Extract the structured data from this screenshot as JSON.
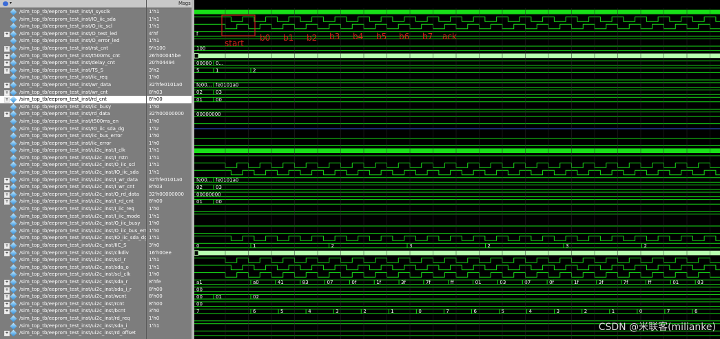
{
  "header": {
    "msgs": "Msgs"
  },
  "signals": [
    {
      "name": "/sim_top_tb/eeprom_test_inst/I_sysclk",
      "value": "1'h1",
      "exp": false,
      "sel": false,
      "type": "clock",
      "period": 8,
      "color": "#18e018"
    },
    {
      "name": "/sim_top_tb/eeprom_test_inst/IO_iic_sda",
      "value": "1'h1",
      "exp": false,
      "sel": false,
      "type": "sda",
      "color": "#18e018"
    },
    {
      "name": "/sim_top_tb/eeprom_test_inst/O_iic_scl",
      "value": "1'h1",
      "exp": false,
      "sel": false,
      "type": "scl",
      "color": "#18e018"
    },
    {
      "name": "/sim_top_tb/eeprom_test_inst/O_test_led",
      "value": "4'hf",
      "exp": true,
      "sel": false,
      "type": "bus",
      "labels": [
        "f"
      ],
      "color": "#18e018"
    },
    {
      "name": "/sim_top_tb/eeprom_test_inst/O_error_led",
      "value": "1'h1",
      "exp": false,
      "sel": false,
      "type": "high",
      "color": "#18e018"
    },
    {
      "name": "/sim_top_tb/eeprom_test_inst/rst_cnt",
      "value": "9'h100",
      "exp": true,
      "sel": false,
      "type": "bus",
      "labels": [
        "100"
      ],
      "color": "#18e018"
    },
    {
      "name": "/sim_top_tb/eeprom_test_inst/t500ms_cnt",
      "value": "26'h00045be",
      "exp": true,
      "sel": false,
      "type": "dense",
      "color": "#b8ffb0"
    },
    {
      "name": "/sim_top_tb/eeprom_test_inst/delay_cnt",
      "value": "20'h04494",
      "exp": true,
      "sel": false,
      "type": "bus",
      "labels": [
        "00000",
        "0..."
      ],
      "color": "#18e018"
    },
    {
      "name": "/sim_top_tb/eeprom_test_inst/TS_S",
      "value": "3'h2",
      "exp": true,
      "sel": false,
      "type": "bus",
      "labels": [
        "5",
        "1",
        "2"
      ],
      "color": "#18e018"
    },
    {
      "name": "/sim_top_tb/eeprom_test_inst/iic_req",
      "value": "1'h0",
      "exp": false,
      "sel": false,
      "type": "low",
      "color": "#18e018"
    },
    {
      "name": "/sim_top_tb/eeprom_test_inst/wr_data",
      "value": "32'hfe0101a0",
      "exp": true,
      "sel": false,
      "type": "bus",
      "labels": [
        "fe00...",
        "fe0101a0"
      ],
      "color": "#18e018"
    },
    {
      "name": "/sim_top_tb/eeprom_test_inst/wr_cnt",
      "value": "8'h03",
      "exp": true,
      "sel": false,
      "type": "bus",
      "labels": [
        "02",
        "03"
      ],
      "color": "#18e018"
    },
    {
      "name": "/sim_top_tb/eeprom_test_inst/rd_cnt",
      "value": "8'h00",
      "exp": true,
      "sel": true,
      "type": "bus",
      "labels": [
        "01",
        "00"
      ],
      "color": "#18e018"
    },
    {
      "name": "/sim_top_tb/eeprom_test_inst/iic_busy",
      "value": "1'h0",
      "exp": false,
      "sel": false,
      "type": "low",
      "color": "#18e018"
    },
    {
      "name": "/sim_top_tb/eeprom_test_inst/rd_data",
      "value": "32'h00000000",
      "exp": true,
      "sel": false,
      "type": "bus",
      "labels": [
        "00000000"
      ],
      "color": "#18e018"
    },
    {
      "name": "/sim_top_tb/eeprom_test_inst/t500ms_en",
      "value": "1'h0",
      "exp": false,
      "sel": false,
      "type": "low",
      "color": "#18e018"
    },
    {
      "name": "/sim_top_tb/eeprom_test_inst/IO_iic_sda_dg",
      "value": "1'hz",
      "exp": false,
      "sel": false,
      "type": "z",
      "color": "#2a4cc8"
    },
    {
      "name": "/sim_top_tb/eeprom_test_inst/iic_bus_error",
      "value": "1'h0",
      "exp": false,
      "sel": false,
      "type": "low",
      "color": "#18e018"
    },
    {
      "name": "/sim_top_tb/eeprom_test_inst/iic_error",
      "value": "1'h0",
      "exp": false,
      "sel": false,
      "type": "low",
      "color": "#18e018"
    },
    {
      "name": "/sim_top_tb/eeprom_test_inst/ui2c_inst/I_clk",
      "value": "1'h1",
      "exp": false,
      "sel": false,
      "type": "clock",
      "period": 8,
      "color": "#18e018"
    },
    {
      "name": "/sim_top_tb/eeprom_test_inst/ui2c_inst/I_rstn",
      "value": "1'h1",
      "exp": false,
      "sel": false,
      "type": "high",
      "color": "#18e018"
    },
    {
      "name": "/sim_top_tb/eeprom_test_inst/ui2c_inst/O_iic_scl",
      "value": "1'h1",
      "exp": false,
      "sel": false,
      "type": "scl",
      "color": "#18e018"
    },
    {
      "name": "/sim_top_tb/eeprom_test_inst/ui2c_inst/IO_iic_sda",
      "value": "1'h1",
      "exp": false,
      "sel": false,
      "type": "sda",
      "color": "#18e018"
    },
    {
      "name": "/sim_top_tb/eeprom_test_inst/ui2c_inst/I_wr_data",
      "value": "32'hfe0101a0",
      "exp": true,
      "sel": false,
      "type": "bus",
      "labels": [
        "fe00...",
        "fe0101a0"
      ],
      "color": "#18e018"
    },
    {
      "name": "/sim_top_tb/eeprom_test_inst/ui2c_inst/I_wr_cnt",
      "value": "8'h03",
      "exp": true,
      "sel": false,
      "type": "bus",
      "labels": [
        "02",
        "03"
      ],
      "color": "#18e018"
    },
    {
      "name": "/sim_top_tb/eeprom_test_inst/ui2c_inst/O_rd_data",
      "value": "32'h00000000",
      "exp": true,
      "sel": false,
      "type": "bus",
      "labels": [
        "00000000"
      ],
      "color": "#18e018"
    },
    {
      "name": "/sim_top_tb/eeprom_test_inst/ui2c_inst/I_rd_cnt",
      "value": "8'h00",
      "exp": true,
      "sel": false,
      "type": "bus",
      "labels": [
        "01",
        "00"
      ],
      "color": "#18e018"
    },
    {
      "name": "/sim_top_tb/eeprom_test_inst/ui2c_inst/I_iic_req",
      "value": "1'h0",
      "exp": false,
      "sel": false,
      "type": "low",
      "color": "#18e018"
    },
    {
      "name": "/sim_top_tb/eeprom_test_inst/ui2c_inst/I_iic_mode",
      "value": "1'h1",
      "exp": false,
      "sel": false,
      "type": "high",
      "color": "#18e018"
    },
    {
      "name": "/sim_top_tb/eeprom_test_inst/ui2c_inst/O_iic_busy",
      "value": "1'h0",
      "exp": false,
      "sel": false,
      "type": "low",
      "color": "#18e018"
    },
    {
      "name": "/sim_top_tb/eeprom_test_inst/ui2c_inst/O_iic_bus_error",
      "value": "1'h0",
      "exp": false,
      "sel": false,
      "type": "low",
      "color": "#18e018"
    },
    {
      "name": "/sim_top_tb/eeprom_test_inst/ui2c_inst/IO_iic_sda_dg",
      "value": "1'h1",
      "exp": false,
      "sel": false,
      "type": "sda",
      "color": "#18e018"
    },
    {
      "name": "/sim_top_tb/eeprom_test_inst/ui2c_inst/IIC_S",
      "value": "3'h0",
      "exp": true,
      "sel": false,
      "type": "bus",
      "labels": [
        "0",
        "1",
        "2",
        "3",
        "2",
        "3",
        "2"
      ],
      "color": "#18e018"
    },
    {
      "name": "/sim_top_tb/eeprom_test_inst/ui2c_inst/clkdiv",
      "value": "16'h00ee",
      "exp": true,
      "sel": false,
      "type": "dense",
      "color": "#b8ffb0"
    },
    {
      "name": "/sim_top_tb/eeprom_test_inst/ui2c_inst/scl_r",
      "value": "1'h1",
      "exp": false,
      "sel": false,
      "type": "scl",
      "color": "#18e018"
    },
    {
      "name": "/sim_top_tb/eeprom_test_inst/ui2c_inst/sda_o",
      "value": "1'h1",
      "exp": false,
      "sel": false,
      "type": "sda",
      "color": "#18e018"
    },
    {
      "name": "/sim_top_tb/eeprom_test_inst/ui2c_inst/scl_clk",
      "value": "1'h0",
      "exp": false,
      "sel": false,
      "type": "scl",
      "color": "#18e018"
    },
    {
      "name": "/sim_top_tb/eeprom_test_inst/ui2c_inst/sda_r",
      "value": "8'hfe",
      "exp": true,
      "sel": false,
      "type": "bus",
      "labels": [
        "a1",
        "a0",
        "41",
        "83",
        "07",
        "0f",
        "1f",
        "3f",
        "7f",
        "ff",
        "01",
        "03",
        "07",
        "0f",
        "1f",
        "3f",
        "7f",
        "ff",
        "01",
        "03"
      ],
      "color": "#18e018"
    },
    {
      "name": "/sim_top_tb/eeprom_test_inst/ui2c_inst/sda_i_r",
      "value": "8'h00",
      "exp": true,
      "sel": false,
      "type": "bus",
      "labels": [
        "00"
      ],
      "color": "#18e018"
    },
    {
      "name": "/sim_top_tb/eeprom_test_inst/ui2c_inst/wcnt",
      "value": "8'h00",
      "exp": true,
      "sel": false,
      "type": "bus",
      "labels": [
        "00",
        "01",
        "02"
      ],
      "color": "#18e018"
    },
    {
      "name": "/sim_top_tb/eeprom_test_inst/ui2c_inst/rcnt",
      "value": "8'h00",
      "exp": true,
      "sel": false,
      "type": "bus",
      "labels": [
        "00"
      ],
      "color": "#18e018"
    },
    {
      "name": "/sim_top_tb/eeprom_test_inst/ui2c_inst/bcnt",
      "value": "3'h0",
      "exp": true,
      "sel": false,
      "type": "bus",
      "labels": [
        "7",
        "6",
        "5",
        "4",
        "3",
        "2",
        "1",
        "0",
        "7",
        "6",
        "5",
        "4",
        "3",
        "2",
        "1",
        "0",
        "7",
        "6"
      ],
      "color": "#18e018"
    },
    {
      "name": "/sim_top_tb/eeprom_test_inst/ui2c_inst/rd_req",
      "value": "1'h0",
      "exp": false,
      "sel": false,
      "type": "low",
      "color": "#18e018"
    },
    {
      "name": "/sim_top_tb/eeprom_test_inst/ui2c_inst/sda_i",
      "value": "1'h1",
      "exp": false,
      "sel": false,
      "type": "high",
      "color": "#18e018"
    },
    {
      "name": "/sim_top_tb/eeprom_test_inst/ui2c_inst/rd_offset",
      "value": "",
      "exp": true,
      "sel": false,
      "type": "bus",
      "labels": [],
      "color": "#18e018"
    }
  ],
  "annotations": [
    "start",
    "b0",
    "b1",
    "b2",
    "b3",
    "b4",
    "b5",
    "b6",
    "b7",
    "ack"
  ],
  "watermark": "CSDN @米联客(milianke)"
}
